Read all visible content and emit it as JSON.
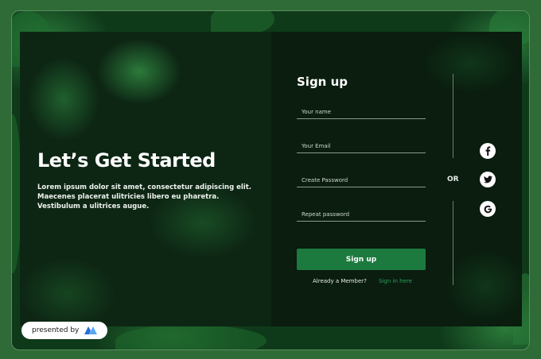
{
  "hero": {
    "headline": "Let’s Get Started",
    "description": "Lorem ipsum dolor sit amet, consectetur adipiscing elit. Maecenes placerat ulitricies libero eu pharetra. Vestibulum a ulitrices augue."
  },
  "form": {
    "title": "Sign up",
    "fields": [
      {
        "placeholder": "Your name",
        "value": ""
      },
      {
        "placeholder": "Your Email",
        "value": ""
      },
      {
        "placeholder": "Create Password",
        "value": ""
      },
      {
        "placeholder": "Repeat password",
        "value": ""
      }
    ],
    "submit_label": "Sign up",
    "member_text": "Already a Member?",
    "signin_link": "Sign in here"
  },
  "divider": {
    "or_label": "OR"
  },
  "social": [
    "facebook-icon",
    "twitter-icon",
    "google-icon"
  ],
  "badge": {
    "text": "presented by"
  },
  "colors": {
    "accent": "#1c7a3f",
    "link": "#2aa35a",
    "panel": "#0a1d0f",
    "background": "#2f6b36"
  }
}
